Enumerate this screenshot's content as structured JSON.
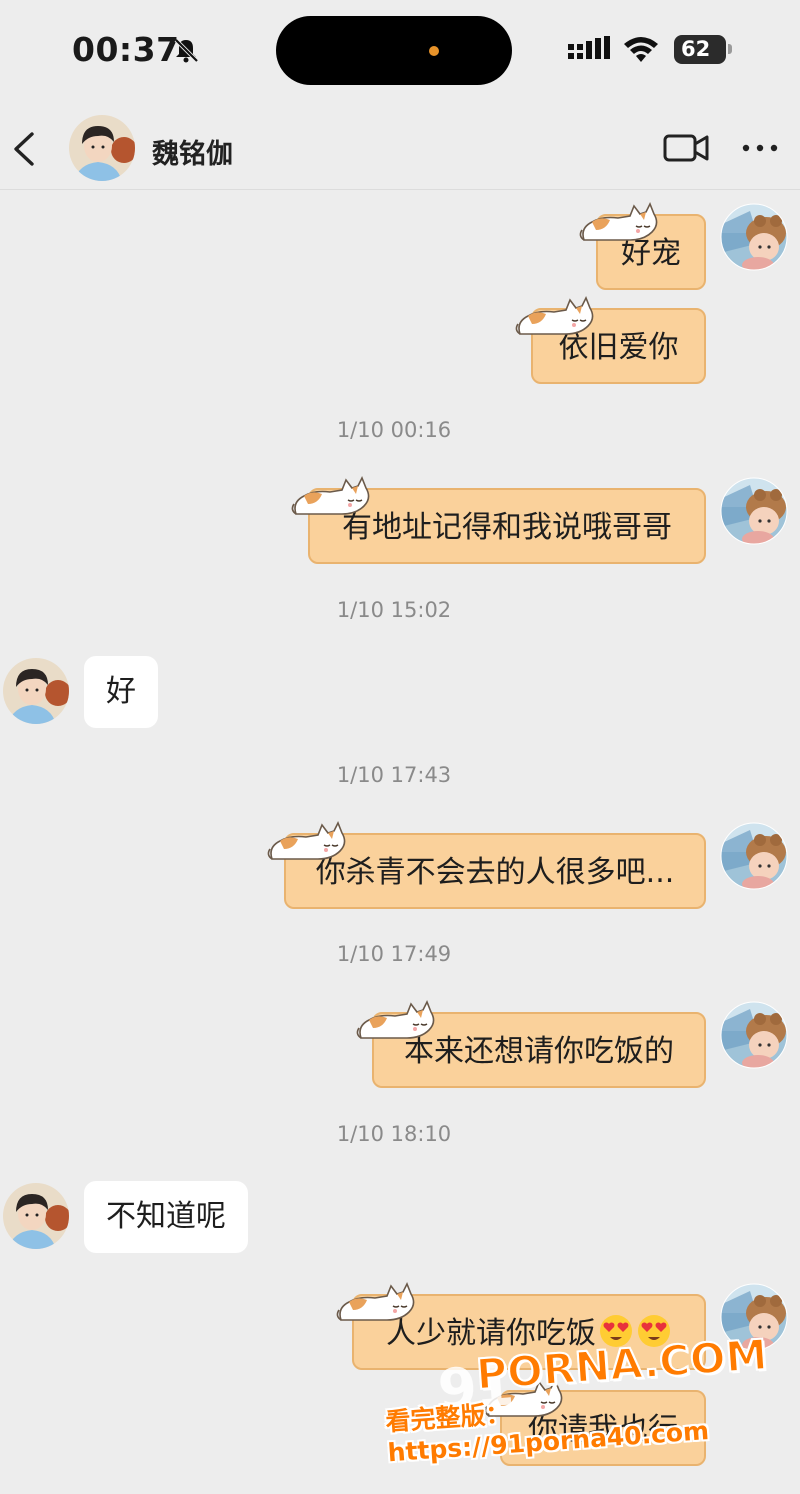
{
  "status_bar": {
    "time": "00:37",
    "battery": "62",
    "icons": [
      "bell-off-icon",
      "signal-icon",
      "wifi-icon",
      "battery-icon"
    ]
  },
  "header": {
    "contact_name": "魏铭伽",
    "icons": [
      "back-icon",
      "video-call-icon",
      "more-icon"
    ]
  },
  "colors": {
    "background": "#ededed",
    "outgoing_bubble": "#fad19b",
    "outgoing_border": "#e9b36f",
    "incoming_bubble": "#ffffff",
    "timestamp": "#8a8a8a",
    "watermark": "#ff7b00"
  },
  "messages": [
    {
      "type": "out",
      "text": "好宠"
    },
    {
      "type": "out",
      "text": "依旧爱你"
    },
    {
      "type": "time",
      "text": "1/10 00:16"
    },
    {
      "type": "out",
      "text": "有地址记得和我说哦哥哥"
    },
    {
      "type": "time",
      "text": "1/10 15:02"
    },
    {
      "type": "in",
      "text": "好"
    },
    {
      "type": "time",
      "text": "1/10 17:43"
    },
    {
      "type": "out",
      "text": "你杀青不会去的人很多吧..."
    },
    {
      "type": "time",
      "text": "1/10 17:49"
    },
    {
      "type": "out",
      "text": "本来还想请你吃饭的"
    },
    {
      "type": "time",
      "text": "1/10 18:10"
    },
    {
      "type": "in",
      "text": "不知道呢"
    },
    {
      "type": "out",
      "text": "人少就请你吃饭",
      "emoji": [
        "heart-eyes-emoji",
        "heart-eyes-emoji"
      ]
    },
    {
      "type": "out",
      "text": "你请我也行"
    }
  ],
  "watermark": {
    "prefix": "91",
    "brand": "PORNA.COM",
    "line": "看完整版：https://91porna40.com"
  }
}
